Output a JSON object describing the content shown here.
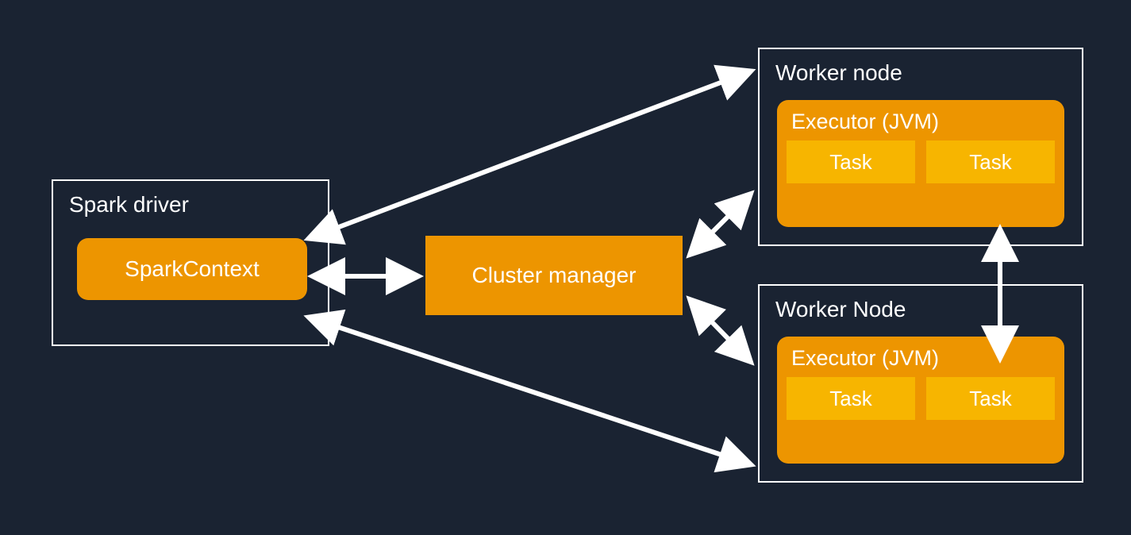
{
  "driver": {
    "title": "Spark driver",
    "context": "SparkContext"
  },
  "cluster_manager": "Cluster manager",
  "workers": [
    {
      "title": "Worker node",
      "executor": "Executor (JVM)",
      "tasks": [
        "Task",
        "Task"
      ]
    },
    {
      "title": "Worker Node",
      "executor": "Executor (JVM)",
      "tasks": [
        "Task",
        "Task"
      ]
    }
  ],
  "colors": {
    "background": "#1a2332",
    "box": "#ed9500",
    "task": "#f7b500",
    "stroke": "#ffffff"
  }
}
